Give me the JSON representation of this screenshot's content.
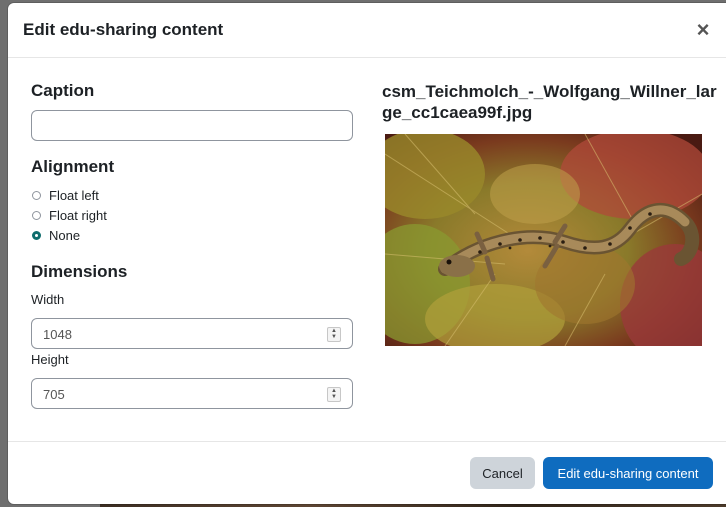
{
  "dialog": {
    "title": "Edit edu-sharing content",
    "close_symbol": "×"
  },
  "form": {
    "caption_heading": "Caption",
    "caption_value": "",
    "alignment_heading": "Alignment",
    "alignment_options": [
      {
        "label": "Float left",
        "checked": false
      },
      {
        "label": "Float right",
        "checked": false
      },
      {
        "label": "None",
        "checked": true
      }
    ],
    "dimensions_heading": "Dimensions",
    "width_label": "Width",
    "width_value": "1048",
    "height_label": "Height",
    "height_value": "705"
  },
  "preview": {
    "filename": "csm_Teichmolch_-_Wolfgang_Willner_large_cc1caea99f.jpg",
    "icon": "newt-photo"
  },
  "footer": {
    "cancel_label": "Cancel",
    "submit_label": "Edit edu-sharing content"
  },
  "colors": {
    "primary": "#0f6cbf",
    "secondary": "#ced4da",
    "radio_checked": "#0f6c6c"
  }
}
